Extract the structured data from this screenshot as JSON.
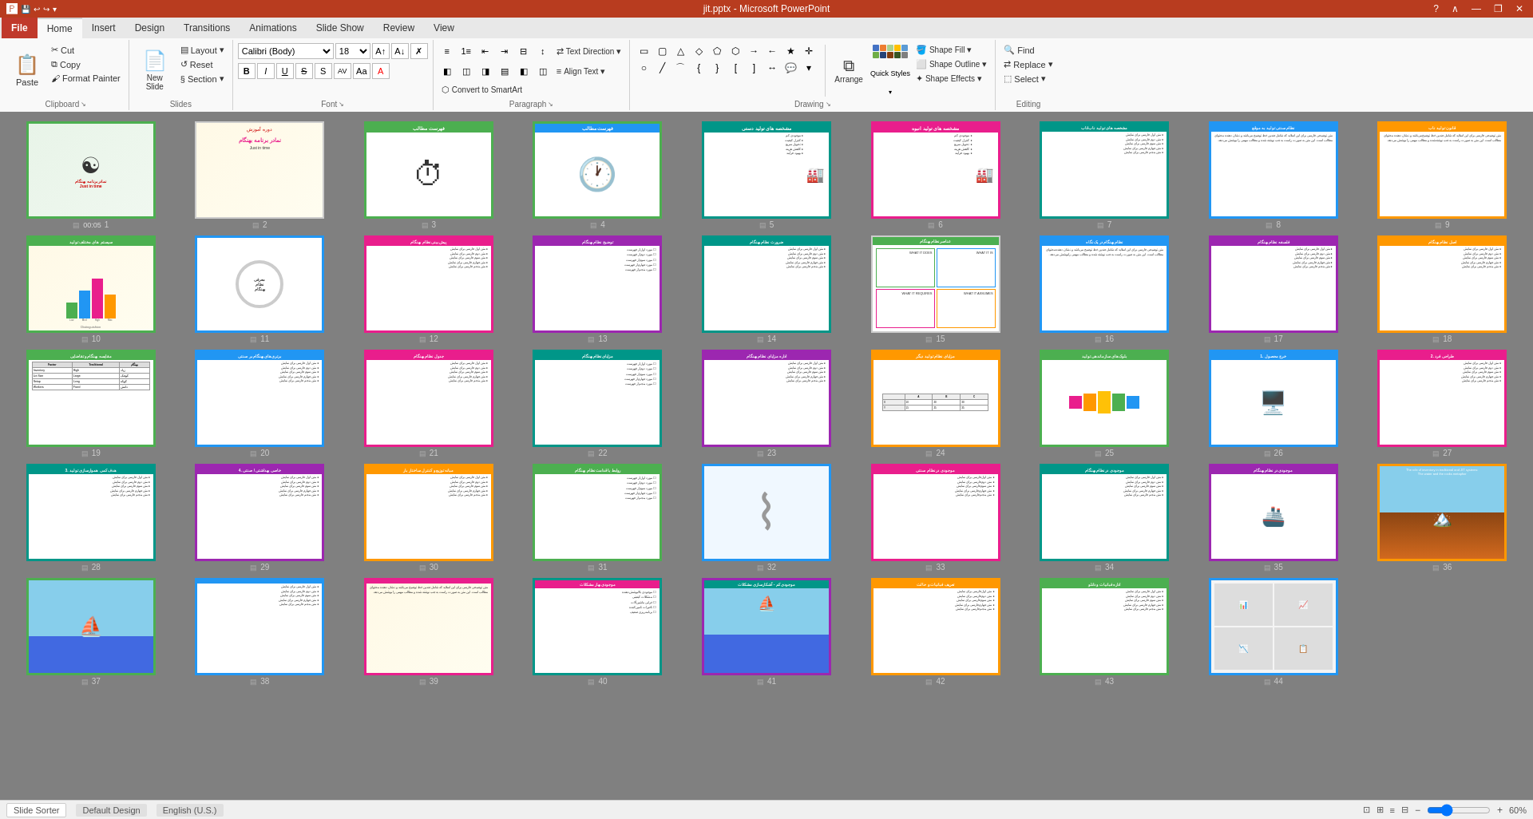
{
  "titleBar": {
    "title": "jit.pptx - Microsoft PowerPoint",
    "quickAccessButtons": [
      "save",
      "undo",
      "redo",
      "customize"
    ],
    "windowButtons": [
      "minimize",
      "restore",
      "close"
    ],
    "helpIcon": "?"
  },
  "ribbon": {
    "tabs": [
      {
        "id": "file",
        "label": "File",
        "active": false,
        "isFile": true
      },
      {
        "id": "home",
        "label": "Home",
        "active": true
      },
      {
        "id": "insert",
        "label": "Insert"
      },
      {
        "id": "design",
        "label": "Design"
      },
      {
        "id": "transitions",
        "label": "Transitions"
      },
      {
        "id": "animations",
        "label": "Animations"
      },
      {
        "id": "slideshow",
        "label": "Slide Show"
      },
      {
        "id": "review",
        "label": "Review"
      },
      {
        "id": "view",
        "label": "View"
      }
    ],
    "groups": {
      "clipboard": {
        "label": "Clipboard",
        "paste": "Paste",
        "cut": "Cut",
        "copy": "Copy",
        "formatPainter": "Format Painter"
      },
      "slides": {
        "label": "Slides",
        "newSlide": "New\nSlide",
        "layout": "Layout",
        "reset": "Reset",
        "section": "Section"
      },
      "font": {
        "label": "Font",
        "fontName": "Calibri (Body)",
        "fontSize": "18",
        "bold": "B",
        "italic": "I",
        "underline": "U",
        "strikethrough": "S",
        "shadow": "S",
        "charSpacing": "AV",
        "changeCase": "Aa",
        "fontColor": "A",
        "increaseFontSize": "A↑",
        "decreaseFontSize": "A↓",
        "clearFormatting": "✗"
      },
      "paragraph": {
        "label": "Paragraph",
        "bullets": "≡",
        "numbering": "1≡",
        "decreaseIndent": "←≡",
        "increaseIndent": "→≡",
        "columns": "⊟",
        "lineSpacing": "↕",
        "textDirection": "Text Direction",
        "alignText": "Align Text",
        "convertToSmartArt": "Convert to SmartArt",
        "alignLeft": "◧",
        "alignCenter": "◫",
        "alignRight": "◨",
        "justify": "▤",
        "alignLeft2": "◧",
        "alignCenter2": "◫"
      },
      "drawing": {
        "label": "Drawing",
        "shapes": [
          "rect",
          "rounded-rect",
          "triangle",
          "diamond",
          "pentagon",
          "hexagon",
          "arrow-right",
          "arrow-left",
          "star",
          "cross"
        ],
        "shapeFill": "Shape Fill",
        "shapeOutline": "Shape Outline",
        "shapeEffects": "Shape Effects",
        "arrange": "Arrange",
        "quickStyles": "Quick Styles"
      },
      "editing": {
        "label": "Editing",
        "find": "Find",
        "replace": "Replace",
        "select": "Select"
      }
    }
  },
  "slides": [
    {
      "num": 1,
      "time": "00:05",
      "colorClass": "slide-color-1",
      "borderClass": "border-colored",
      "type": "logo",
      "title": ""
    },
    {
      "num": 2,
      "time": "",
      "colorClass": "slide-color-2",
      "borderClass": "",
      "type": "text-rtl",
      "title": ""
    },
    {
      "num": 3,
      "time": "",
      "colorClass": "slide-color-5",
      "borderClass": "border-colored",
      "type": "clock",
      "titleColor": "slide-header-green",
      "titleText": "فهرست مطالب"
    },
    {
      "num": 4,
      "time": "",
      "colorClass": "slide-color-5",
      "borderClass": "border-colored",
      "type": "clock2",
      "titleColor": "slide-header-blue",
      "titleText": "فهرست مطالب"
    },
    {
      "num": 5,
      "time": "",
      "colorClass": "slide-color-5",
      "borderClass": "border-teal",
      "type": "img-text",
      "titleColor": "slide-header-teal",
      "titleText": "مشخصه های تولید دستی"
    },
    {
      "num": 6,
      "time": "",
      "colorClass": "slide-color-5",
      "borderClass": "border-pink",
      "type": "img-text",
      "titleColor": "slide-header-pink",
      "titleText": "مشخصه های تولید انبوه"
    },
    {
      "num": 7,
      "time": "",
      "colorClass": "slide-color-5",
      "borderClass": "border-teal",
      "type": "text-list",
      "titleColor": "slide-header-teal",
      "titleText": "مشخصه های تولید ناب/ناب"
    },
    {
      "num": 8,
      "time": "",
      "colorClass": "slide-color-5",
      "borderClass": "border-blue",
      "type": "text-only",
      "titleColor": "slide-header-blue",
      "titleText": "نظام سنتی تولید به موقع"
    },
    {
      "num": 9,
      "time": "",
      "colorClass": "slide-color-5",
      "borderClass": "border-orange",
      "type": "text-only",
      "titleColor": "slide-header-orange",
      "titleText": "قانون تولید ناب"
    },
    {
      "num": 10,
      "time": "",
      "colorClass": "slide-color-2",
      "borderClass": "border-colored",
      "type": "chart",
      "titleColor": "slide-header-green",
      "titleText": "سیستم های مختلف تولید"
    },
    {
      "num": 11,
      "time": "",
      "colorClass": "slide-color-5",
      "borderClass": "border-blue",
      "type": "circle-text",
      "titleColor": "",
      "titleText": ""
    },
    {
      "num": 12,
      "time": "",
      "colorClass": "slide-color-5",
      "borderClass": "border-pink",
      "type": "text-list",
      "titleColor": "slide-header-pink",
      "titleText": "پیش بینی نظام بهنگام"
    },
    {
      "num": 13,
      "time": "",
      "colorClass": "slide-color-5",
      "borderClass": "border-purple",
      "type": "checklist",
      "titleColor": "slide-header-purple",
      "titleText": "توضیح نظام بهنگام"
    },
    {
      "num": 14,
      "time": "",
      "colorClass": "slide-color-5",
      "borderClass": "border-teal",
      "type": "text-list",
      "titleColor": "slide-header-teal",
      "titleText": "ضرورت نظام بهنگام"
    },
    {
      "num": 15,
      "time": "",
      "colorClass": "slide-color-5",
      "borderClass": "border-green2",
      "type": "4box",
      "titleColor": "slide-header-green",
      "titleText": "عناصر نظام بهنگام"
    },
    {
      "num": 16,
      "time": "",
      "colorClass": "slide-color-5",
      "borderClass": "border-blue",
      "type": "text-only",
      "titleColor": "slide-header-blue",
      "titleText": "نظام بهنگام در یک نگاه"
    },
    {
      "num": 17,
      "time": "",
      "colorClass": "slide-color-5",
      "borderClass": "border-purple",
      "type": "text-list",
      "titleColor": "slide-header-purple",
      "titleText": "فلسفه نظام بهنگام"
    },
    {
      "num": 18,
      "time": "",
      "colorClass": "slide-color-5",
      "borderClass": "border-orange",
      "type": "text-list",
      "titleColor": "slide-header-orange",
      "titleText": "اصل نظام بهنگام"
    },
    {
      "num": 19,
      "time": "",
      "colorClass": "slide-color-5",
      "borderClass": "border-colored",
      "type": "table",
      "titleColor": "slide-header-green",
      "titleText": "مقایسه بهنگام و تقاضایی"
    },
    {
      "num": 20,
      "time": "",
      "colorClass": "slide-color-5",
      "borderClass": "border-blue",
      "type": "text-list",
      "titleColor": "slide-header-blue",
      "titleText": "برتری‌های بهنگام بر سنتی"
    },
    {
      "num": 21,
      "time": "",
      "colorClass": "slide-color-5",
      "borderClass": "border-pink",
      "type": "text-list",
      "titleColor": "slide-header-pink",
      "titleText": "جدول نظام بهنگام"
    },
    {
      "num": 22,
      "time": "",
      "colorClass": "slide-color-5",
      "borderClass": "border-teal",
      "type": "checklist",
      "titleColor": "slide-header-teal",
      "titleText": "مزایای نظام بهنگام"
    },
    {
      "num": 23,
      "time": "",
      "colorClass": "slide-color-5",
      "borderClass": "border-purple",
      "type": "text-list",
      "titleColor": "slide-header-purple",
      "titleText": "اداره مزایای نظام بهنگام"
    },
    {
      "num": 24,
      "time": "",
      "colorClass": "slide-color-5",
      "borderClass": "border-orange",
      "type": "chart2",
      "titleColor": "slide-header-orange",
      "titleText": "مزایای نظام تولید دیگر"
    },
    {
      "num": 25,
      "time": "",
      "colorClass": "slide-color-5",
      "borderClass": "border-colored",
      "type": "blocks",
      "titleColor": "slide-header-green",
      "titleText": "بلوک‌های سازماندهی تولید"
    },
    {
      "num": 26,
      "time": "",
      "colorClass": "slide-color-5",
      "borderClass": "border-blue",
      "type": "img-desk",
      "titleColor": "slide-header-blue",
      "titleText": "1. خرج محصول"
    },
    {
      "num": 27,
      "time": "",
      "colorClass": "slide-color-5",
      "borderClass": "border-pink",
      "type": "text-list",
      "titleColor": "slide-header-pink",
      "titleText": "2. طراحی فرد"
    },
    {
      "num": 28,
      "time": "",
      "colorClass": "slide-color-5",
      "borderClass": "border-teal",
      "type": "text-list",
      "titleColor": "slide-header-teal",
      "titleText": "3. هدف کمی‌ هموارسازی تولید"
    },
    {
      "num": 29,
      "time": "",
      "colorClass": "slide-color-5",
      "borderClass": "border-purple",
      "type": "text-list",
      "titleColor": "slide-header-purple",
      "titleText": "4. خاصی بهداشتی / صنتی"
    },
    {
      "num": 30,
      "time": "",
      "colorClass": "slide-color-5",
      "borderClass": "border-orange",
      "type": "text-list",
      "titleColor": "slide-header-orange",
      "titleText": "مبانه توزیع و کنترل ساختار بار"
    },
    {
      "num": 31,
      "time": "",
      "colorClass": "slide-color-5",
      "borderClass": "border-colored",
      "type": "checklist",
      "titleColor": "slide-header-green",
      "titleText": "روابط با قدامت نظام بهنگام"
    },
    {
      "num": 32,
      "time": "",
      "colorClass": "slide-color-2",
      "borderClass": "border-blue",
      "type": "circle-arch",
      "titleColor": "",
      "titleText": ""
    },
    {
      "num": 33,
      "time": "",
      "colorClass": "slide-color-5",
      "borderClass": "border-pink",
      "type": "text-list",
      "titleColor": "slide-header-pink",
      "titleText": "موجودی در نظام سنتی"
    },
    {
      "num": 34,
      "time": "",
      "colorClass": "slide-color-5",
      "borderClass": "border-teal",
      "type": "text-list",
      "titleColor": "slide-header-teal",
      "titleText": "موجودی در نظام بهنگام"
    },
    {
      "num": 35,
      "time": "",
      "colorClass": "slide-color-5",
      "borderClass": "border-purple",
      "type": "ship-text",
      "titleColor": "slide-header-purple",
      "titleText": "موجودی در نظام بهنگام"
    },
    {
      "num": 36,
      "time": "",
      "colorClass": "slide-color-4",
      "borderClass": "border-orange",
      "type": "sea-chart",
      "titleColor": "slide-header-orange",
      "titleText": "The role of inventory..."
    },
    {
      "num": 37,
      "time": "",
      "colorClass": "slide-color-5",
      "borderClass": "border-colored",
      "type": "ship2",
      "titleColor": "",
      "titleText": ""
    },
    {
      "num": 38,
      "time": "",
      "colorClass": "slide-color-5",
      "borderClass": "border-blue",
      "type": "text-list",
      "titleColor": "slide-header-blue",
      "titleText": ""
    },
    {
      "num": 39,
      "time": "",
      "colorClass": "slide-color-2",
      "borderClass": "border-pink",
      "type": "text-only",
      "titleColor": "slide-header-pink",
      "titleText": ""
    },
    {
      "num": 40,
      "time": "",
      "colorClass": "slide-color-5",
      "borderClass": "border-teal",
      "type": "checklist-pink",
      "titleColor": "slide-header-pink",
      "titleText": "موجودی بهار مشکلات"
    },
    {
      "num": 41,
      "time": "",
      "colorClass": "slide-color-4",
      "borderClass": "border-purple",
      "type": "boat-text",
      "titleColor": "slide-header-teal",
      "titleText": "موجودی کم - آشکارسازی مشکلات"
    },
    {
      "num": 42,
      "time": "",
      "colorClass": "slide-color-5",
      "borderClass": "border-orange",
      "type": "text-list",
      "titleColor": "slide-header-orange",
      "titleText": "تعریف فبانیات و حالت"
    },
    {
      "num": 43,
      "time": "",
      "colorClass": "slide-color-5",
      "borderClass": "border-colored",
      "type": "text-list",
      "titleColor": "slide-header-green",
      "titleText": "اداره فبانیات و دانلو"
    },
    {
      "num": 44,
      "time": "",
      "colorClass": "slide-color-2",
      "borderClass": "border-blue",
      "type": "img-grid",
      "titleColor": "",
      "titleText": ""
    }
  ],
  "statusBar": {
    "slideSorter": "Slide Sorter",
    "defaultDesign": "Default Design",
    "language": "English (U.S.)",
    "zoom": "60%",
    "viewButtons": [
      "normal",
      "slide-sorter",
      "notes-page",
      "reading"
    ],
    "zoomSlider": 60
  }
}
